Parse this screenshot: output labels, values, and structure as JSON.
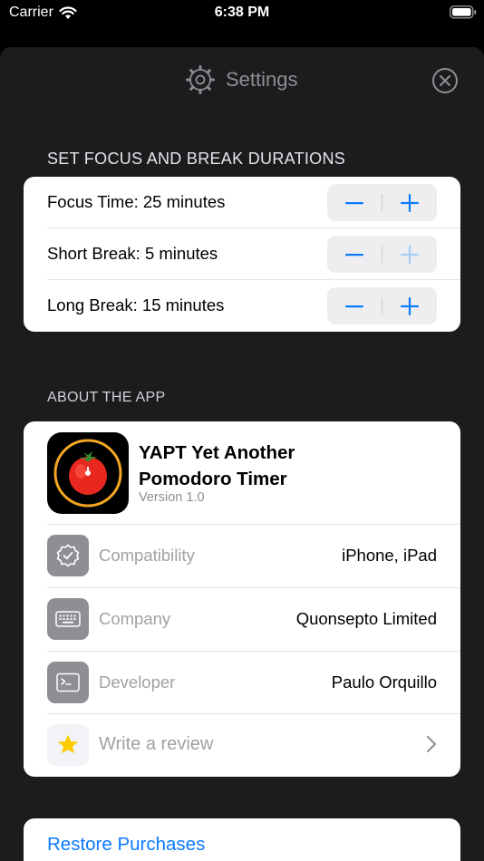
{
  "status": {
    "carrier": "Carrier",
    "time": "6:38 PM"
  },
  "header": {
    "title": "Settings"
  },
  "durations": {
    "section_title": "SET FOCUS AND BREAK DURATIONS",
    "rows": [
      {
        "label": "Focus Time: 25 minutes",
        "plus_enabled": true
      },
      {
        "label": "Short Break: 5 minutes",
        "plus_enabled": false
      },
      {
        "label": "Long Break: 15 minutes",
        "plus_enabled": true
      }
    ]
  },
  "about": {
    "section_title": "ABOUT THE APP",
    "app_name": "YAPT Yet Another Pomodoro Timer",
    "version": "Version 1.0",
    "rows": [
      {
        "key": "Compatibility",
        "value": "iPhone, iPad",
        "icon": "checkmark-seal-icon"
      },
      {
        "key": "Company",
        "value": "Quonsepto Limited",
        "icon": "keyboard-icon"
      },
      {
        "key": "Developer",
        "value": "Paulo Orquillo",
        "icon": "terminal-icon"
      }
    ],
    "review_label": "Write a review"
  },
  "restore": {
    "label": "Restore Purchases"
  },
  "colors": {
    "accent": "#0a7aff",
    "sheet_bg": "#1c1c1e",
    "star": "#ffcc00",
    "tomato_ring": "#f5a623",
    "tomato": "#e8281f"
  }
}
